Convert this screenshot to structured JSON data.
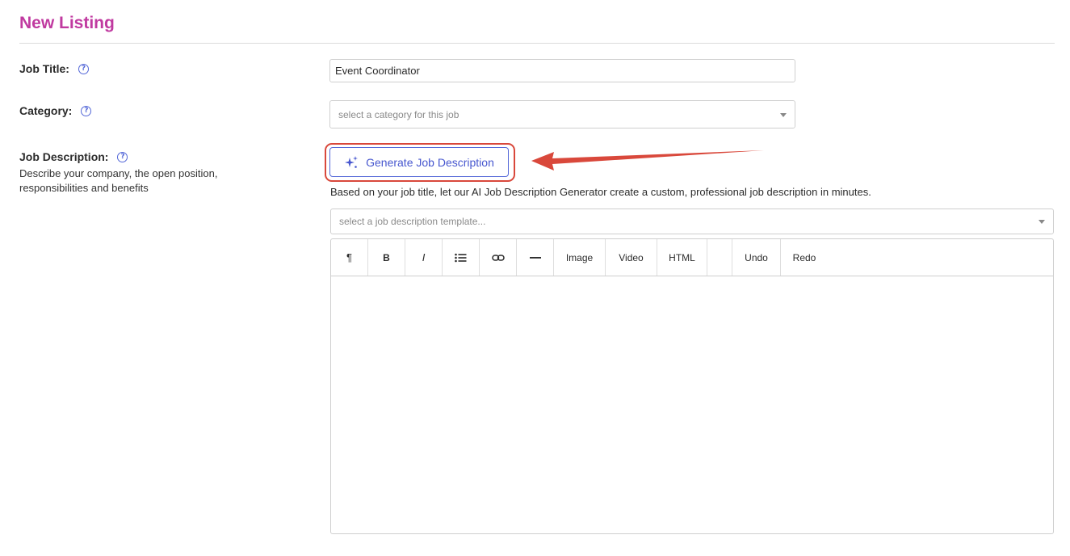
{
  "page": {
    "title": "New Listing"
  },
  "job_title": {
    "label": "Job Title:",
    "value": "Event Coordinator",
    "help_icon": "question-circle"
  },
  "category": {
    "label": "Category:",
    "placeholder": "select a category for this job",
    "help_icon": "question-circle"
  },
  "job_description": {
    "label": "Job Description:",
    "sublabel": "Describe your company, the open position, responsibilities and benefits",
    "help_icon": "question-circle",
    "generate_button": "Generate Job Description",
    "helper_text": "Based on your job title, let our AI Job Description Generator create a custom, professional job description in minutes.",
    "template_placeholder": "select a job description template..."
  },
  "editor": {
    "toolbar": {
      "paragraph": "¶",
      "bold": "B",
      "italic": "I",
      "image": "Image",
      "video": "Video",
      "html": "HTML",
      "undo": "Undo",
      "redo": "Redo"
    },
    "content": ""
  },
  "colors": {
    "title": "#c03aa0",
    "accent": "#5468d8",
    "annotation": "#d9483b"
  }
}
